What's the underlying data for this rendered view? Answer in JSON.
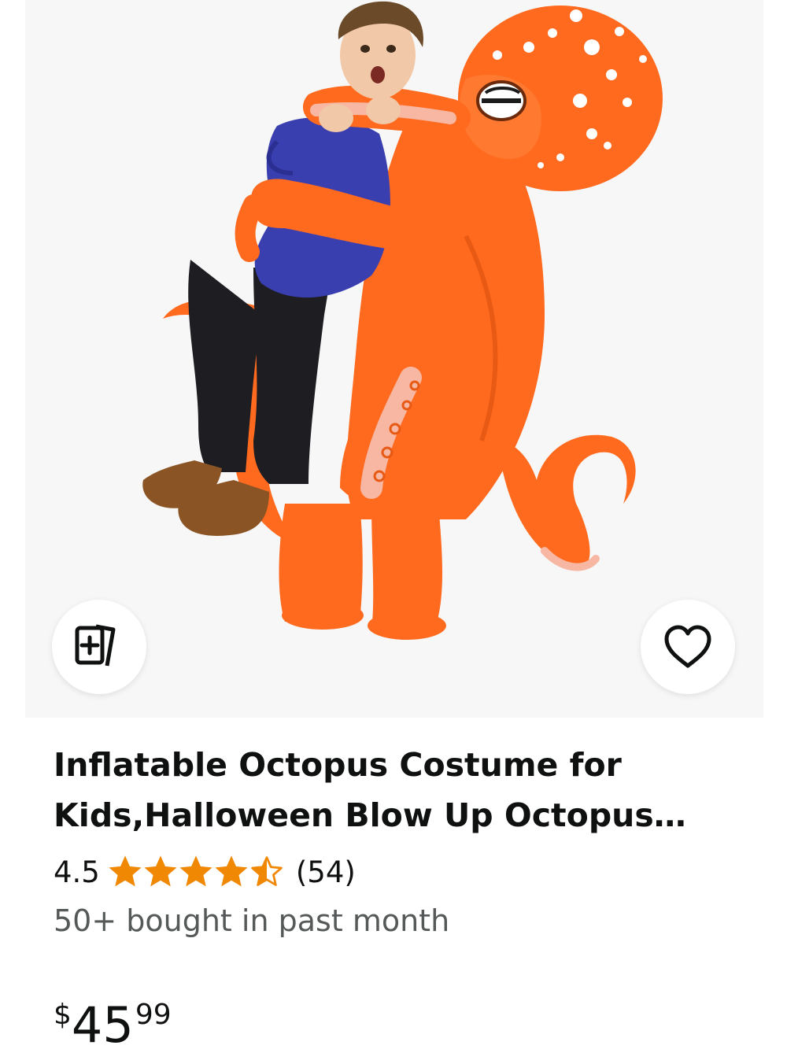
{
  "product": {
    "title": "Inflatable Octopus Costume for Kids,Halloween Blow Up Octopus…",
    "rating": "4.5",
    "rating_stars": 4.5,
    "rating_max": 5,
    "review_count": "(54)",
    "bought_text": "50+ bought in past month",
    "price_symbol": "$",
    "price_whole": "45",
    "price_fraction": "99"
  },
  "icons": {
    "compare": "compare-cards-icon",
    "wishlist": "heart-outline-icon",
    "star": "star-icon"
  },
  "colors": {
    "star": "#f08804",
    "text": "#0f1111",
    "secondary_text": "#565959",
    "image_background": "#f7f7f7",
    "octopus": "#ff6a1f",
    "octopus_shadow": "#e85a14",
    "sucker": "#f7b7a3",
    "shirt": "#3a3fb0",
    "pants": "#1d1d22",
    "boots": "#8a5424"
  }
}
